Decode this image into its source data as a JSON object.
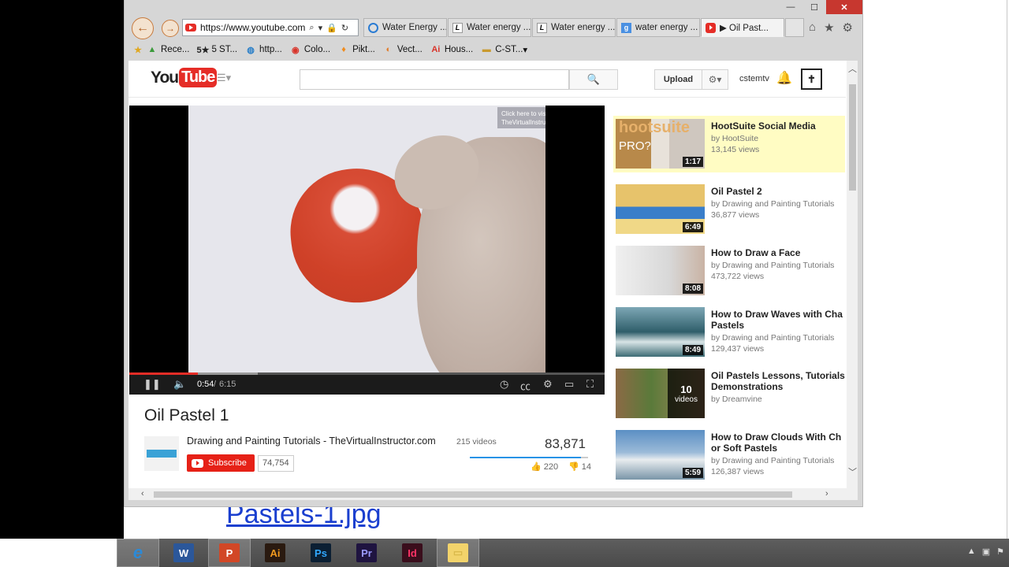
{
  "browser": {
    "url": "https://www.youtube.com",
    "tabs": [
      {
        "label": "Water Energy ...",
        "favicon": "ie-icon",
        "active": false
      },
      {
        "label": "Water energy ...",
        "favicon": "l-icon",
        "active": false
      },
      {
        "label": "Water energy ...",
        "favicon": "l-icon",
        "active": false
      },
      {
        "label": "water energy ...",
        "favicon": "g-icon",
        "active": false
      },
      {
        "label": "▶ Oil Past...",
        "favicon": "youtube-icon",
        "active": true
      }
    ],
    "favorites": [
      {
        "label": "Rece...",
        "icon": "drive-icon"
      },
      {
        "label": "5 ST...",
        "icon": "five-icon"
      },
      {
        "label": "http...",
        "icon": "globe-icon"
      },
      {
        "label": "Colo...",
        "icon": "color-icon"
      },
      {
        "label": "Pikt...",
        "icon": "piktochart-icon"
      },
      {
        "label": "Vect...",
        "icon": "vector-icon"
      },
      {
        "label": "Hous...",
        "icon": "adobe-icon"
      },
      {
        "label": "C-ST...",
        "icon": "folder-icon"
      }
    ],
    "window_close": "✕",
    "window_max": "☐",
    "window_min": "—"
  },
  "youtube": {
    "logo_you": "You",
    "logo_tube": "Tube",
    "search_placeholder": "",
    "upload_label": "Upload",
    "username": "cstemtv",
    "player": {
      "annotation_line1": "Click here to visit",
      "annotation_line2": "TheVirtualInstructor.com",
      "time_current": "0:54",
      "time_separator": "/",
      "time_total": "6:15",
      "progress_fraction": 0.144,
      "buffer_fraction": 0.27
    },
    "video": {
      "title": "Oil Pastel 1",
      "channel": "Drawing and Painting Tutorials - TheVirtualInstructor.com",
      "video_count": "215 videos",
      "subscribe_label": "Subscribe",
      "subscriber_count": "74,754",
      "views": "83,871",
      "likes": "220",
      "dislikes": "14",
      "like_fraction": 0.94
    },
    "sidebar": [
      {
        "title": "HootSuite Social Media",
        "title2": "",
        "author": "by HootSuite",
        "views": "13,145 views",
        "duration": "1:17",
        "featured": true,
        "thumb_text": "hootsuite",
        "thumb_text2": "PRO?"
      },
      {
        "title": "Oil Pastel 2",
        "title2": "",
        "author": "by Drawing and Painting Tutorials",
        "views": "36,877 views",
        "duration": "6:49",
        "featured": false
      },
      {
        "title": "How to Draw a Face",
        "title2": "",
        "author": "by Drawing and Painting Tutorials",
        "views": "473,722 views",
        "duration": "8:08",
        "featured": false
      },
      {
        "title": "How to Draw Waves with Cha",
        "title2": "Pastels",
        "author": "by Drawing and Painting Tutorials",
        "views": "129,437 views",
        "duration": "8:49",
        "featured": false
      },
      {
        "title": "Oil Pastels Lessons, Tutorials",
        "title2": "Demonstrations",
        "author": "by Dreamvine",
        "views": "",
        "duration": "",
        "playlist_count": "10",
        "playlist_label": "videos",
        "featured": false
      },
      {
        "title": "How to Draw Clouds With Ch",
        "title2": "or Soft Pastels",
        "author": "by Drawing and Painting Tutorials",
        "views": "126,387 views",
        "duration": "5:59",
        "featured": false
      }
    ]
  },
  "document": {
    "link_text": "Pastels-1.jpg"
  },
  "taskbar": [
    {
      "name": "internet-explorer",
      "glyph": "e",
      "color": "#2b8ad8",
      "active": true
    },
    {
      "name": "word",
      "glyph": "W",
      "color": "#2b579a",
      "active": false
    },
    {
      "name": "powerpoint",
      "glyph": "P",
      "color": "#d24726",
      "active": true
    },
    {
      "name": "illustrator",
      "glyph": "Ai",
      "color": "#f29a1f",
      "active": false
    },
    {
      "name": "photoshop",
      "glyph": "Ps",
      "color": "#31a8ff",
      "active": false
    },
    {
      "name": "premiere",
      "glyph": "Pr",
      "color": "#9999ff",
      "active": false
    },
    {
      "name": "indesign",
      "glyph": "Id",
      "color": "#ff3366",
      "active": false
    },
    {
      "name": "file-explorer",
      "glyph": "▭",
      "color": "#f2d36b",
      "active": true
    }
  ],
  "colors": {
    "youtube_red": "#e52d27",
    "featured_bg": "#fffcc3",
    "link_blue": "#1a3fcf"
  }
}
